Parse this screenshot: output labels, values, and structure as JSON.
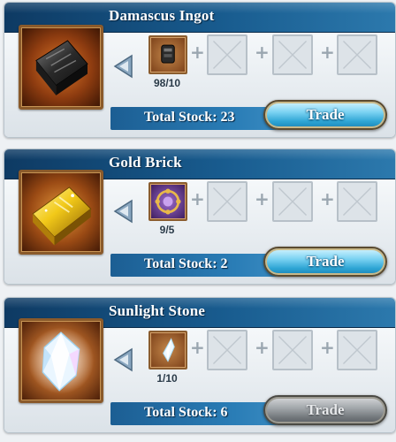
{
  "colors": {
    "header_bg": "#185b8e",
    "stock_bar_bg": "#2a7db6",
    "trade_button_active": "#2ea5d4",
    "trade_button_disabled": "#8d9296"
  },
  "trade_items": [
    {
      "name": "Damascus Ingot",
      "image_icon": "damascus-ingot-icon",
      "requirement": {
        "icon": "ingot-material-icon",
        "count": "98/10"
      },
      "empty_slots": 3,
      "total_stock": "Total Stock: 23",
      "trade_label": "Trade",
      "trade_enabled": true
    },
    {
      "name": "Gold Brick",
      "image_icon": "gold-brick-icon",
      "requirement": {
        "icon": "orb-material-icon",
        "count": "9/5"
      },
      "empty_slots": 3,
      "total_stock": "Total Stock: 2",
      "trade_label": "Trade",
      "trade_enabled": true
    },
    {
      "name": "Sunlight Stone",
      "image_icon": "sunlight-stone-icon",
      "requirement": {
        "icon": "crystal-shard-icon",
        "count": "1/10"
      },
      "empty_slots": 3,
      "total_stock": "Total Stock: 6",
      "trade_label": "Trade",
      "trade_enabled": false
    }
  ]
}
